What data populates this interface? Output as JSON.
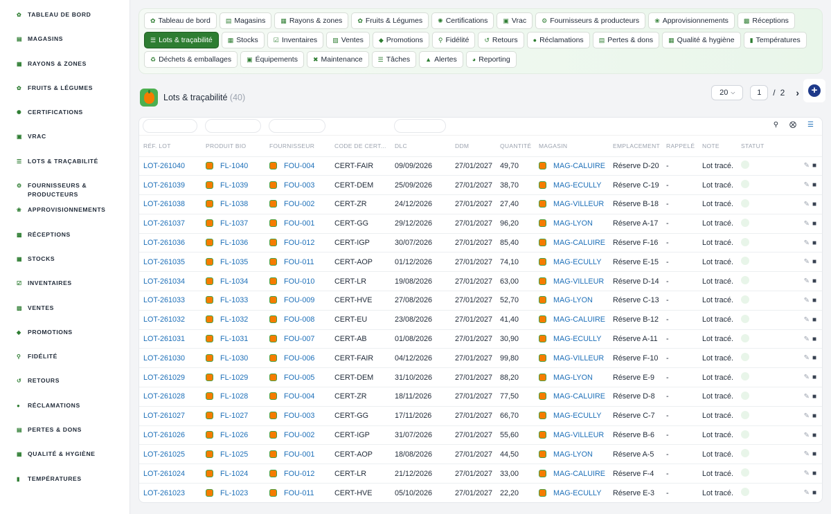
{
  "sidebar": {
    "items": [
      {
        "label": "Tableau de bord",
        "icon": "leaf-icon"
      },
      {
        "label": "Magasins",
        "icon": "store-icon"
      },
      {
        "label": "Rayons & zones",
        "icon": "grid-icon"
      },
      {
        "label": "Fruits & légumes",
        "icon": "leaf-icon"
      },
      {
        "label": "Certifications",
        "icon": "badge-icon"
      },
      {
        "label": "Vrac",
        "icon": "boxes-icon"
      },
      {
        "label": "Lots & traçabilité",
        "icon": "list-icon"
      },
      {
        "label": "Fournisseurs & producteurs",
        "icon": "tractor-icon"
      },
      {
        "label": "Approvisionnements",
        "icon": "seedling-icon"
      },
      {
        "label": "Réceptions",
        "icon": "truck-icon"
      },
      {
        "label": "Stocks",
        "icon": "warehouse-icon"
      },
      {
        "label": "Inventaires",
        "icon": "clipboard-icon"
      },
      {
        "label": "Ventes",
        "icon": "cash-register-icon"
      },
      {
        "label": "Promotions",
        "icon": "tag-icon"
      },
      {
        "label": "Fidélité",
        "icon": "ribbon-icon"
      },
      {
        "label": "Retours",
        "icon": "undo-icon"
      },
      {
        "label": "Réclamations",
        "icon": "comment-icon"
      },
      {
        "label": "Pertes & dons",
        "icon": "receipt-icon"
      },
      {
        "label": "Qualité & hygiène",
        "icon": "document-icon"
      },
      {
        "label": "Températures",
        "icon": "thermometer-icon"
      }
    ]
  },
  "nav": {
    "chips": [
      {
        "label": "Tableau de bord",
        "icon": "leaf-icon",
        "active": false
      },
      {
        "label": "Magasins",
        "icon": "store-icon",
        "active": false
      },
      {
        "label": "Rayons & zones",
        "icon": "grid-icon",
        "active": false
      },
      {
        "label": "Fruits & Légumes",
        "icon": "leaf-icon",
        "active": false
      },
      {
        "label": "Certifications",
        "icon": "badge-icon",
        "active": false
      },
      {
        "label": "Vrac",
        "icon": "boxes-icon",
        "active": false
      },
      {
        "label": "Fournisseurs & producteurs",
        "icon": "tractor-icon",
        "active": false
      },
      {
        "label": "Approvisionnements",
        "icon": "seedling-icon",
        "active": false
      },
      {
        "label": "Réceptions",
        "icon": "truck-icon",
        "active": false
      },
      {
        "label": "Lots & traçabilité",
        "icon": "list-icon",
        "active": true
      },
      {
        "label": "Stocks",
        "icon": "warehouse-icon",
        "active": false
      },
      {
        "label": "Inventaires",
        "icon": "clipboard-icon",
        "active": false
      },
      {
        "label": "Ventes",
        "icon": "cash-register-icon",
        "active": false
      },
      {
        "label": "Promotions",
        "icon": "tag-icon",
        "active": false
      },
      {
        "label": "Fidélité",
        "icon": "ribbon-icon",
        "active": false
      },
      {
        "label": "Retours",
        "icon": "undo-icon",
        "active": false
      },
      {
        "label": "Réclamations",
        "icon": "comment-icon",
        "active": false
      },
      {
        "label": "Pertes & dons",
        "icon": "receipt-icon",
        "active": false
      },
      {
        "label": "Qualité & hygiène",
        "icon": "document-icon",
        "active": false
      },
      {
        "label": "Températures",
        "icon": "thermometer-icon",
        "active": false
      },
      {
        "label": "Déchets & emballages",
        "icon": "recycle-icon",
        "active": false
      },
      {
        "label": "Équipements",
        "icon": "equipment-icon",
        "active": false
      },
      {
        "label": "Maintenance",
        "icon": "tools-icon",
        "active": false
      },
      {
        "label": "Tâches",
        "icon": "tasks-icon",
        "active": false
      },
      {
        "label": "Alertes",
        "icon": "bell-icon",
        "active": false
      },
      {
        "label": "Reporting",
        "icon": "pie-chart-icon",
        "active": false
      }
    ]
  },
  "header": {
    "title": "Lots & traçabilité",
    "count": "(40)"
  },
  "pager": {
    "page_size": "20",
    "current_page": "1",
    "separator": "/",
    "total_pages": "2"
  },
  "colors": {
    "accent": "#2e7d32",
    "link": "#1d6fb8",
    "add_button": "#1e3a8a"
  },
  "table": {
    "columns": [
      "Réf. lot",
      "Produit bio",
      "Fournisseur",
      "Code de cert...",
      "DLC",
      "DDM",
      "Quantité",
      "Magasin",
      "Emplacement",
      "Rappelé",
      "Note",
      "Statut",
      ""
    ],
    "rows": [
      [
        "LOT-261040",
        "FL-1040",
        "FOU-004",
        "CERT-FAIR",
        "09/09/2026",
        "27/01/2027",
        "49,70",
        "MAG-CALUIRE",
        "Réserve D-20",
        "-",
        "Lot tracé."
      ],
      [
        "LOT-261039",
        "FL-1039",
        "FOU-003",
        "CERT-DEM",
        "25/09/2026",
        "27/01/2027",
        "38,70",
        "MAG-ECULLY",
        "Réserve C-19",
        "-",
        "Lot tracé."
      ],
      [
        "LOT-261038",
        "FL-1038",
        "FOU-002",
        "CERT-ZR",
        "24/12/2026",
        "27/01/2027",
        "27,40",
        "MAG-VILLEUR",
        "Réserve B-18",
        "-",
        "Lot tracé."
      ],
      [
        "LOT-261037",
        "FL-1037",
        "FOU-001",
        "CERT-GG",
        "29/12/2026",
        "27/01/2027",
        "96,20",
        "MAG-LYON",
        "Réserve A-17",
        "-",
        "Lot tracé."
      ],
      [
        "LOT-261036",
        "FL-1036",
        "FOU-012",
        "CERT-IGP",
        "30/07/2026",
        "27/01/2027",
        "85,40",
        "MAG-CALUIRE",
        "Réserve F-16",
        "-",
        "Lot tracé."
      ],
      [
        "LOT-261035",
        "FL-1035",
        "FOU-011",
        "CERT-AOP",
        "01/12/2026",
        "27/01/2027",
        "74,10",
        "MAG-ECULLY",
        "Réserve E-15",
        "-",
        "Lot tracé."
      ],
      [
        "LOT-261034",
        "FL-1034",
        "FOU-010",
        "CERT-LR",
        "19/08/2026",
        "27/01/2027",
        "63,00",
        "MAG-VILLEUR",
        "Réserve D-14",
        "-",
        "Lot tracé."
      ],
      [
        "LOT-261033",
        "FL-1033",
        "FOU-009",
        "CERT-HVE",
        "27/08/2026",
        "27/01/2027",
        "52,70",
        "MAG-LYON",
        "Réserve C-13",
        "-",
        "Lot tracé."
      ],
      [
        "LOT-261032",
        "FL-1032",
        "FOU-008",
        "CERT-EU",
        "23/08/2026",
        "27/01/2027",
        "41,40",
        "MAG-CALUIRE",
        "Réserve B-12",
        "-",
        "Lot tracé."
      ],
      [
        "LOT-261031",
        "FL-1031",
        "FOU-007",
        "CERT-AB",
        "01/08/2026",
        "27/01/2027",
        "30,90",
        "MAG-ECULLY",
        "Réserve A-11",
        "-",
        "Lot tracé."
      ],
      [
        "LOT-261030",
        "FL-1030",
        "FOU-006",
        "CERT-FAIR",
        "04/12/2026",
        "27/01/2027",
        "99,80",
        "MAG-VILLEUR",
        "Réserve F-10",
        "-",
        "Lot tracé."
      ],
      [
        "LOT-261029",
        "FL-1029",
        "FOU-005",
        "CERT-DEM",
        "31/10/2026",
        "27/01/2027",
        "88,20",
        "MAG-LYON",
        "Réserve E-9",
        "-",
        "Lot tracé."
      ],
      [
        "LOT-261028",
        "FL-1028",
        "FOU-004",
        "CERT-ZR",
        "18/11/2026",
        "27/01/2027",
        "77,50",
        "MAG-CALUIRE",
        "Réserve D-8",
        "-",
        "Lot tracé."
      ],
      [
        "LOT-261027",
        "FL-1027",
        "FOU-003",
        "CERT-GG",
        "17/11/2026",
        "27/01/2027",
        "66,70",
        "MAG-ECULLY",
        "Réserve C-7",
        "-",
        "Lot tracé."
      ],
      [
        "LOT-261026",
        "FL-1026",
        "FOU-002",
        "CERT-IGP",
        "31/07/2026",
        "27/01/2027",
        "55,60",
        "MAG-VILLEUR",
        "Réserve B-6",
        "-",
        "Lot tracé."
      ],
      [
        "LOT-261025",
        "FL-1025",
        "FOU-001",
        "CERT-AOP",
        "18/08/2026",
        "27/01/2027",
        "44,50",
        "MAG-LYON",
        "Réserve A-5",
        "-",
        "Lot tracé."
      ],
      [
        "LOT-261024",
        "FL-1024",
        "FOU-012",
        "CERT-LR",
        "21/12/2026",
        "27/01/2027",
        "33,00",
        "MAG-CALUIRE",
        "Réserve F-4",
        "-",
        "Lot tracé."
      ],
      [
        "LOT-261023",
        "FL-1023",
        "FOU-011",
        "CERT-HVE",
        "05/10/2026",
        "27/01/2027",
        "22,20",
        "MAG-ECULLY",
        "Réserve E-3",
        "-",
        "Lot tracé."
      ]
    ]
  }
}
